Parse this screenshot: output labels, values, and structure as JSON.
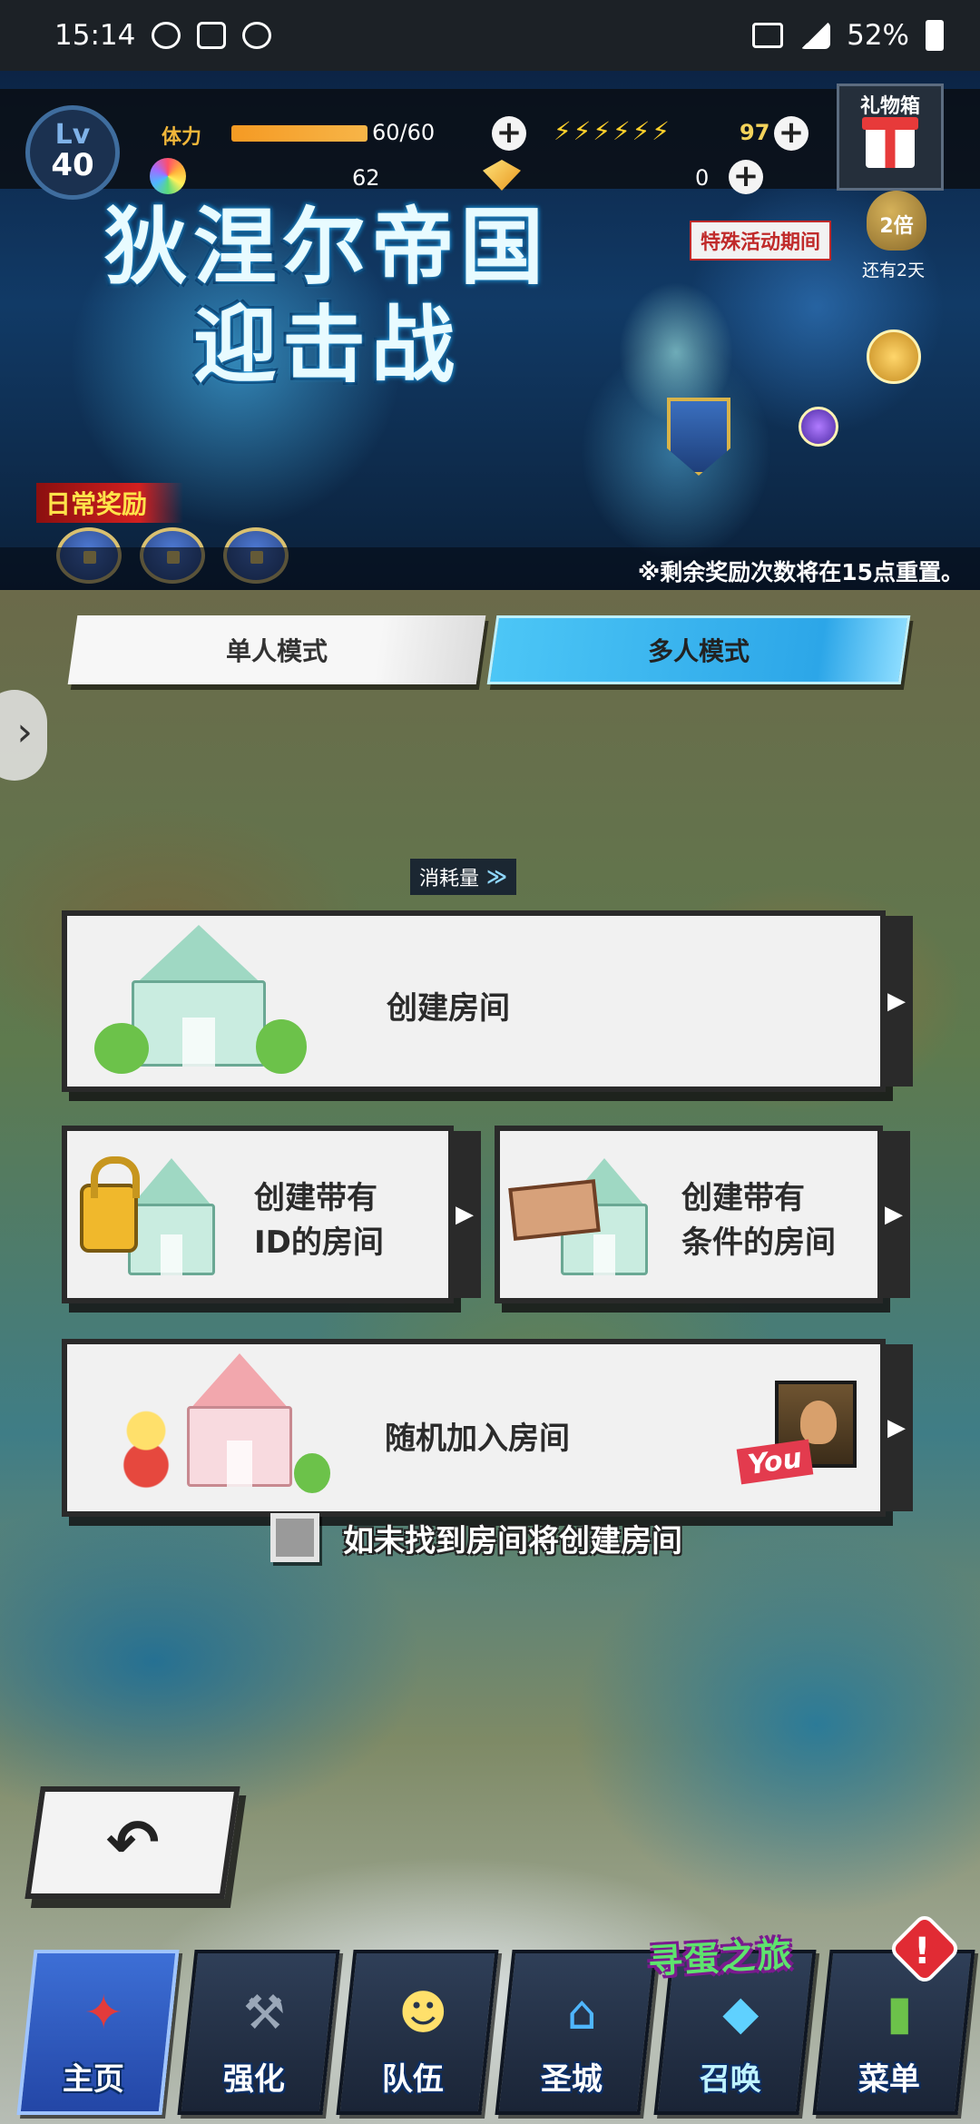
{
  "status_bar": {
    "time": "15:14",
    "battery": "52%",
    "icons": [
      "app-notification-icon",
      "image-icon",
      "timer-icon",
      "data-icon",
      "signal-icon",
      "battery-icon"
    ]
  },
  "header": {
    "level_label": "Lv",
    "level": "40",
    "stamina_label": "体力",
    "stamina_text": "60/60",
    "stamina_fraction": 1.0,
    "bolt_count": "97",
    "rainbow_gems": "62",
    "gold_gems": "0",
    "gift_box_label": "礼物箱",
    "bonus_multiplier": "2倍",
    "bonus_remaining": "还有2天"
  },
  "banner": {
    "title_line1": "狄涅尔帝国",
    "title_line2": "迎击战",
    "event_period": "特殊活动期间",
    "daily_rewards_label": "日常奖励",
    "reset_note": "※剩余奖励次数将在15点重置。"
  },
  "mode_tabs": [
    {
      "label": "单人模式",
      "active": false
    },
    {
      "label": "多人模式",
      "active": true
    }
  ],
  "cost_label": "消耗量",
  "actions": {
    "create_room": "创建房间",
    "create_id_room_line1": "创建带有",
    "create_id_room_line2": "ID的房间",
    "create_cond_room_line1": "创建带有",
    "create_cond_room_line2": "条件的房间",
    "random_join": "随机加入房间",
    "you_tag": "You"
  },
  "auto_create_label": "如未找到房间将创建房间",
  "event_tag": "寻蛋之旅",
  "nav": [
    {
      "label": "主页",
      "icon": "home-crest-icon"
    },
    {
      "label": "强化",
      "icon": "hammer-icon"
    },
    {
      "label": "队伍",
      "icon": "hero-icon"
    },
    {
      "label": "圣城",
      "icon": "castle-icon"
    },
    {
      "label": "召唤",
      "icon": "crystal-icon"
    },
    {
      "label": "菜单",
      "icon": "book-icon"
    }
  ],
  "colors": {
    "active_tab": "#2ca6e8",
    "stamina": "#f59a23",
    "alert": "#e12b34"
  }
}
